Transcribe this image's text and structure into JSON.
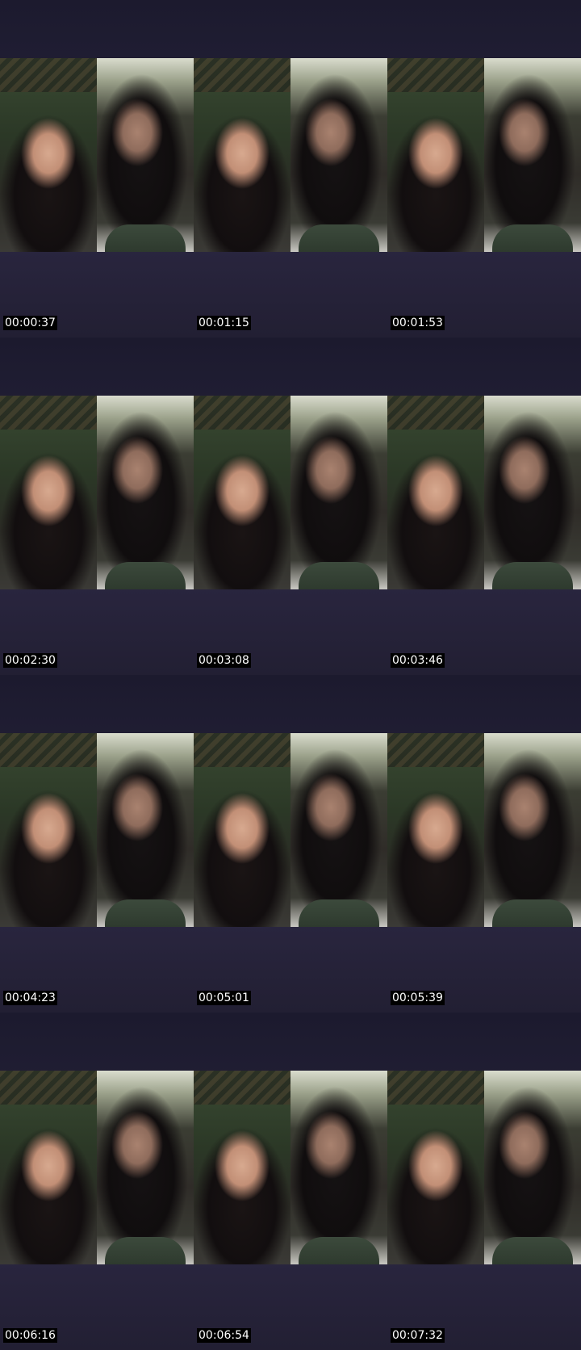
{
  "thumbnails": [
    {
      "timestamp": "00:00:37"
    },
    {
      "timestamp": "00:01:15"
    },
    {
      "timestamp": "00:01:53"
    },
    {
      "timestamp": "00:02:30"
    },
    {
      "timestamp": "00:03:08"
    },
    {
      "timestamp": "00:03:46"
    },
    {
      "timestamp": "00:04:23"
    },
    {
      "timestamp": "00:05:01"
    },
    {
      "timestamp": "00:05:39"
    },
    {
      "timestamp": "00:06:16"
    },
    {
      "timestamp": "00:06:54"
    },
    {
      "timestamp": "00:07:32"
    }
  ],
  "colors": {
    "background": "#221f33",
    "timestamp_bg": "#000000",
    "timestamp_text": "#ffffff"
  }
}
